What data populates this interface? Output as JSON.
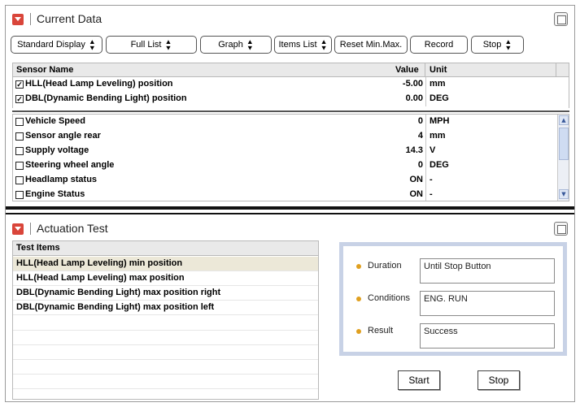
{
  "current_data": {
    "title": "Current Data",
    "toolbar": {
      "standard_display": "Standard Display",
      "full_list": "Full List",
      "graph": "Graph",
      "items_list": "Items List",
      "reset_min_max": "Reset Min.Max.",
      "record": "Record",
      "stop": "Stop"
    },
    "columns": {
      "sensor_name": "Sensor Name",
      "value": "Value",
      "unit": "Unit"
    },
    "fixed_rows": [
      {
        "checked": true,
        "name": "HLL(Head Lamp Leveling) position",
        "value": "-5.00",
        "unit": "mm"
      },
      {
        "checked": true,
        "name": "DBL(Dynamic Bending Light) position",
        "value": "0.00",
        "unit": "DEG"
      }
    ],
    "rows": [
      {
        "checked": false,
        "name": "Vehicle Speed",
        "value": "0",
        "unit": "MPH"
      },
      {
        "checked": false,
        "name": "Sensor angle rear",
        "value": "4",
        "unit": "mm"
      },
      {
        "checked": false,
        "name": "Supply voltage",
        "value": "14.3",
        "unit": "V"
      },
      {
        "checked": false,
        "name": "Steering wheel angle",
        "value": "0",
        "unit": "DEG"
      },
      {
        "checked": false,
        "name": "Headlamp status",
        "value": "ON",
        "unit": "-"
      },
      {
        "checked": false,
        "name": "Engine Status",
        "value": "ON",
        "unit": "-"
      }
    ]
  },
  "actuation_test": {
    "title": "Actuation Test",
    "list_header": "Test Items",
    "items": [
      "HLL(Head Lamp Leveling) min position",
      "HLL(Head Lamp Leveling) max position",
      "DBL(Dynamic Bending Light) max position right",
      "DBL(Dynamic Bending Light) max position left"
    ],
    "info": {
      "duration_label": "Duration",
      "duration_value": "Until Stop Button",
      "conditions_label": "Conditions",
      "conditions_value": "ENG. RUN",
      "result_label": "Result",
      "result_value": "Success"
    },
    "start_label": "Start",
    "stop_label": "Stop"
  }
}
